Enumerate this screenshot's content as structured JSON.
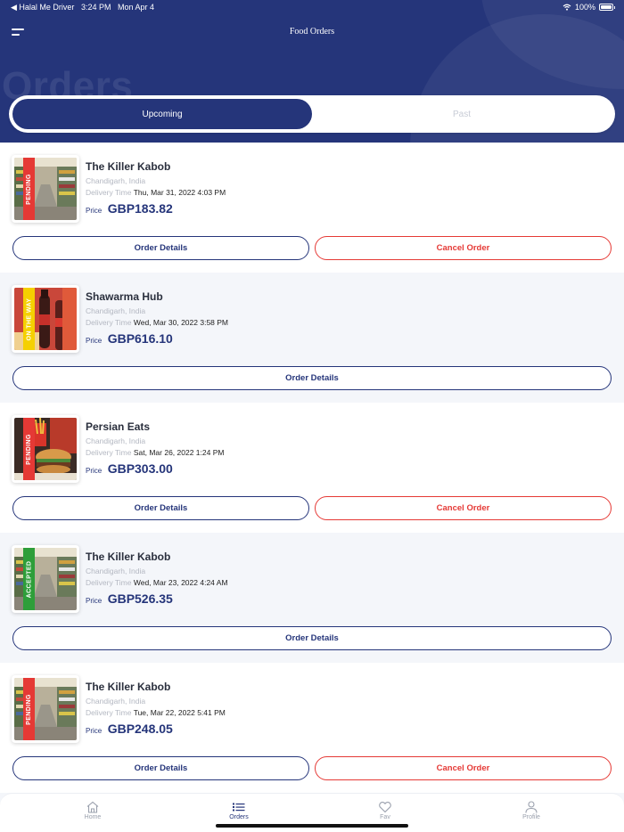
{
  "status_bar": {
    "back_app": "◀ Halal Me Driver",
    "time": "3:24 PM",
    "date": "Mon Apr 4",
    "battery": "100%",
    "battery_level": 1.0
  },
  "header": {
    "title": "Food Orders",
    "watermark": "Orders"
  },
  "tabs": [
    {
      "label": "Upcoming",
      "active": true
    },
    {
      "label": "Past",
      "active": false
    }
  ],
  "labels": {
    "delivery_time": "Delivery Time",
    "price": "Price",
    "order_details": "Order Details",
    "cancel_order": "Cancel Order"
  },
  "orders": [
    {
      "restaurant": "The Killer Kabob",
      "location": "Chandigarh, India",
      "delivery_time": "Thu, Mar 31, 2022 4:03 PM",
      "price": "GBP183.82",
      "status": "PENDING",
      "status_color": "#e53935",
      "image": "grocery-aisle",
      "cancellable": true
    },
    {
      "restaurant": "Shawarma Hub",
      "location": "Chandigarh, India",
      "delivery_time": "Wed, Mar 30, 2022 3:58 PM",
      "price": "GBP616.10",
      "status": "ON THE WAY",
      "status_color": "#f5d000",
      "image": "cola-bottles",
      "cancellable": false
    },
    {
      "restaurant": "Persian Eats",
      "location": "Chandigarh, India",
      "delivery_time": "Sat, Mar 26, 2022 1:24 PM",
      "price": "GBP303.00",
      "status": "PENDING",
      "status_color": "#e53935",
      "image": "burger-fries",
      "cancellable": true
    },
    {
      "restaurant": "The Killer Kabob",
      "location": "Chandigarh, India",
      "delivery_time": "Wed, Mar 23, 2022 4:24 AM",
      "price": "GBP526.35",
      "status": "ACCEPTED",
      "status_color": "#2e9e3a",
      "image": "grocery-aisle",
      "cancellable": false
    },
    {
      "restaurant": "The Killer Kabob",
      "location": "Chandigarh, India",
      "delivery_time": "Tue, Mar 22, 2022 5:41 PM",
      "price": "GBP248.05",
      "status": "PENDING",
      "status_color": "#e53935",
      "image": "grocery-aisle",
      "cancellable": true
    }
  ],
  "bottom_nav": [
    {
      "label": "Home",
      "icon": "home-icon",
      "active": false
    },
    {
      "label": "Orders",
      "icon": "list-icon",
      "active": true
    },
    {
      "label": "Fav",
      "icon": "heart-icon",
      "active": false
    },
    {
      "label": "Profile",
      "icon": "person-icon",
      "active": false
    }
  ],
  "colors": {
    "primary": "#25357a",
    "cancel": "#e53935"
  }
}
